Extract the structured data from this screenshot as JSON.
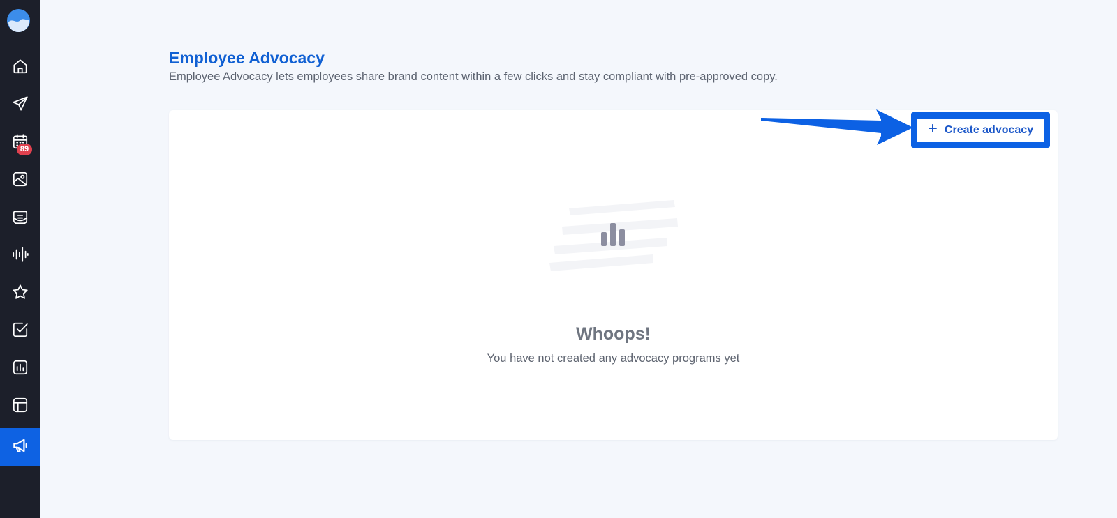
{
  "header": {
    "title": "Employee Advocacy",
    "subtitle": "Employee Advocacy lets employees share brand content within a few clicks and stay compliant with pre-approved copy."
  },
  "sidebar": {
    "logo_icon": "wave-logo-icon",
    "items": [
      {
        "icon": "home-icon",
        "active": false
      },
      {
        "icon": "paper-plane-icon",
        "active": false
      },
      {
        "icon": "calendar-icon",
        "active": false,
        "badge": "89"
      },
      {
        "icon": "image-icon",
        "active": false
      },
      {
        "icon": "inbox-icon",
        "active": false
      },
      {
        "icon": "sound-wave-icon",
        "active": false
      },
      {
        "icon": "star-icon",
        "active": false
      },
      {
        "icon": "checkbox-icon",
        "active": false
      },
      {
        "icon": "bar-chart-icon",
        "active": false
      },
      {
        "icon": "layout-icon",
        "active": false
      },
      {
        "icon": "megaphone-icon",
        "active": true
      }
    ]
  },
  "actions": {
    "create_label": "Create advocacy",
    "create_icon": "plus-icon"
  },
  "empty_state": {
    "title": "Whoops!",
    "message": "You have not created any advocacy programs yet",
    "icon": "bar-chart-icon"
  },
  "colors": {
    "sidebar_bg": "#1c1f2a",
    "accent": "#0e62e3",
    "title": "#1060d3",
    "badge": "#e0414f",
    "page_bg": "#f4f7fc"
  }
}
